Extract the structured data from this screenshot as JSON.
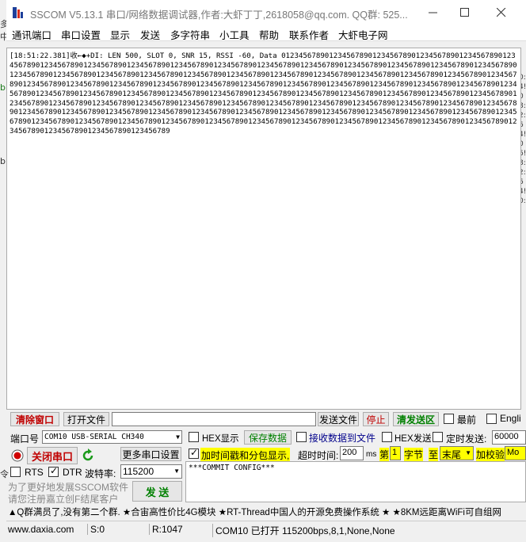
{
  "window": {
    "title": "SSCOM V5.13.1 串口/网络数据调试器,作者:大虾丁丁,2618058@qq.com. QQ群: 525..."
  },
  "menu": [
    "通讯端口",
    "串口设置",
    "显示",
    "发送",
    "多字符串",
    "小工具",
    "帮助",
    "联系作者",
    "大虾电子网"
  ],
  "receive": {
    "text": "[18:51:22.381]收←◆+DI: LEN 500, SLOT 0, SNR 15, RSSI -60, Data 0123456789012345678901234567890123456789012345678901234567890123456789012345678901234567890123456789012345678901234567890123456789012345678901234567890123456789012345678901234567890123456789012345678901234567890123456789012345678901234567890123456789012345678901234567890123456789012345678901234567890123456789012345678901234567890123456789012345678901234567890123456789012345678901234567890123456789012345678901234567890123456789012345678901234567890123456789012345678901234567890123456789012345678901234567890123456789012345678901234567890123456789012345678901234567890123456789012345678901234567890123456789012345678901234567890123456789012345678901234567890123456789012345678901234567890123456789012345678901234567890123456789012345678901234567890123456789012345678901234567890123456789012345678901234567890123456789012345678901234567890123456789012345678901234567890123456789012345678901234567890123456789"
  },
  "toolbar1": {
    "clear_window": "清除窗口",
    "open_file": "打开文件",
    "send_file": "发送文件",
    "stop": "停止",
    "clear_send": "清发送区",
    "latest": "最前",
    "english": "Engli"
  },
  "port": {
    "label": "端口号",
    "value": "COM10 USB-SERIAL CH340",
    "hex_display": "HEX显示",
    "save_data": "保存数据",
    "recv_to_file": "接收数据到文件",
    "hex_send": "HEX发送",
    "timed_send": "定时发送:",
    "timed_value": "60000"
  },
  "row3": {
    "close_port": "关闭串口",
    "more_settings": "更多串口设置",
    "timestamp": "加时间戳和分包显示,",
    "timeout_label": "超时时间:",
    "timeout_value": "200",
    "ms": "ms",
    "nth": "第",
    "nth_value": "1",
    "byte_label": "字节",
    "to": "至",
    "end_value": "末尾",
    "checksum": "加校验",
    "checksum_value": "Mo"
  },
  "row4": {
    "rts": "RTS",
    "dtr": "DTR",
    "baud_label": "波特率:",
    "baud_value": "115200"
  },
  "send": {
    "text": "***COMMIT CONFIG***",
    "button": "发 送"
  },
  "promo": {
    "line1": "为了更好地发展SSCOM软件",
    "line2": "请您注册嘉立创F结尾客户"
  },
  "ticker": "▲Q群满员了,没有第二个群. ★合宙高性价比4G模块 ★RT-Thread中国人的开源免费操作系统 ★ ★8KM远距离WiFi可自组网",
  "status": {
    "site": "www.daxia.com",
    "s": "S:0",
    "r": "R:1047",
    "port_state": "COM10 已打开  115200bps,8,1,None,None"
  },
  "colors": {
    "accent_red": "#c00000",
    "accent_green": "#008000",
    "highlight": "#ffff00"
  }
}
